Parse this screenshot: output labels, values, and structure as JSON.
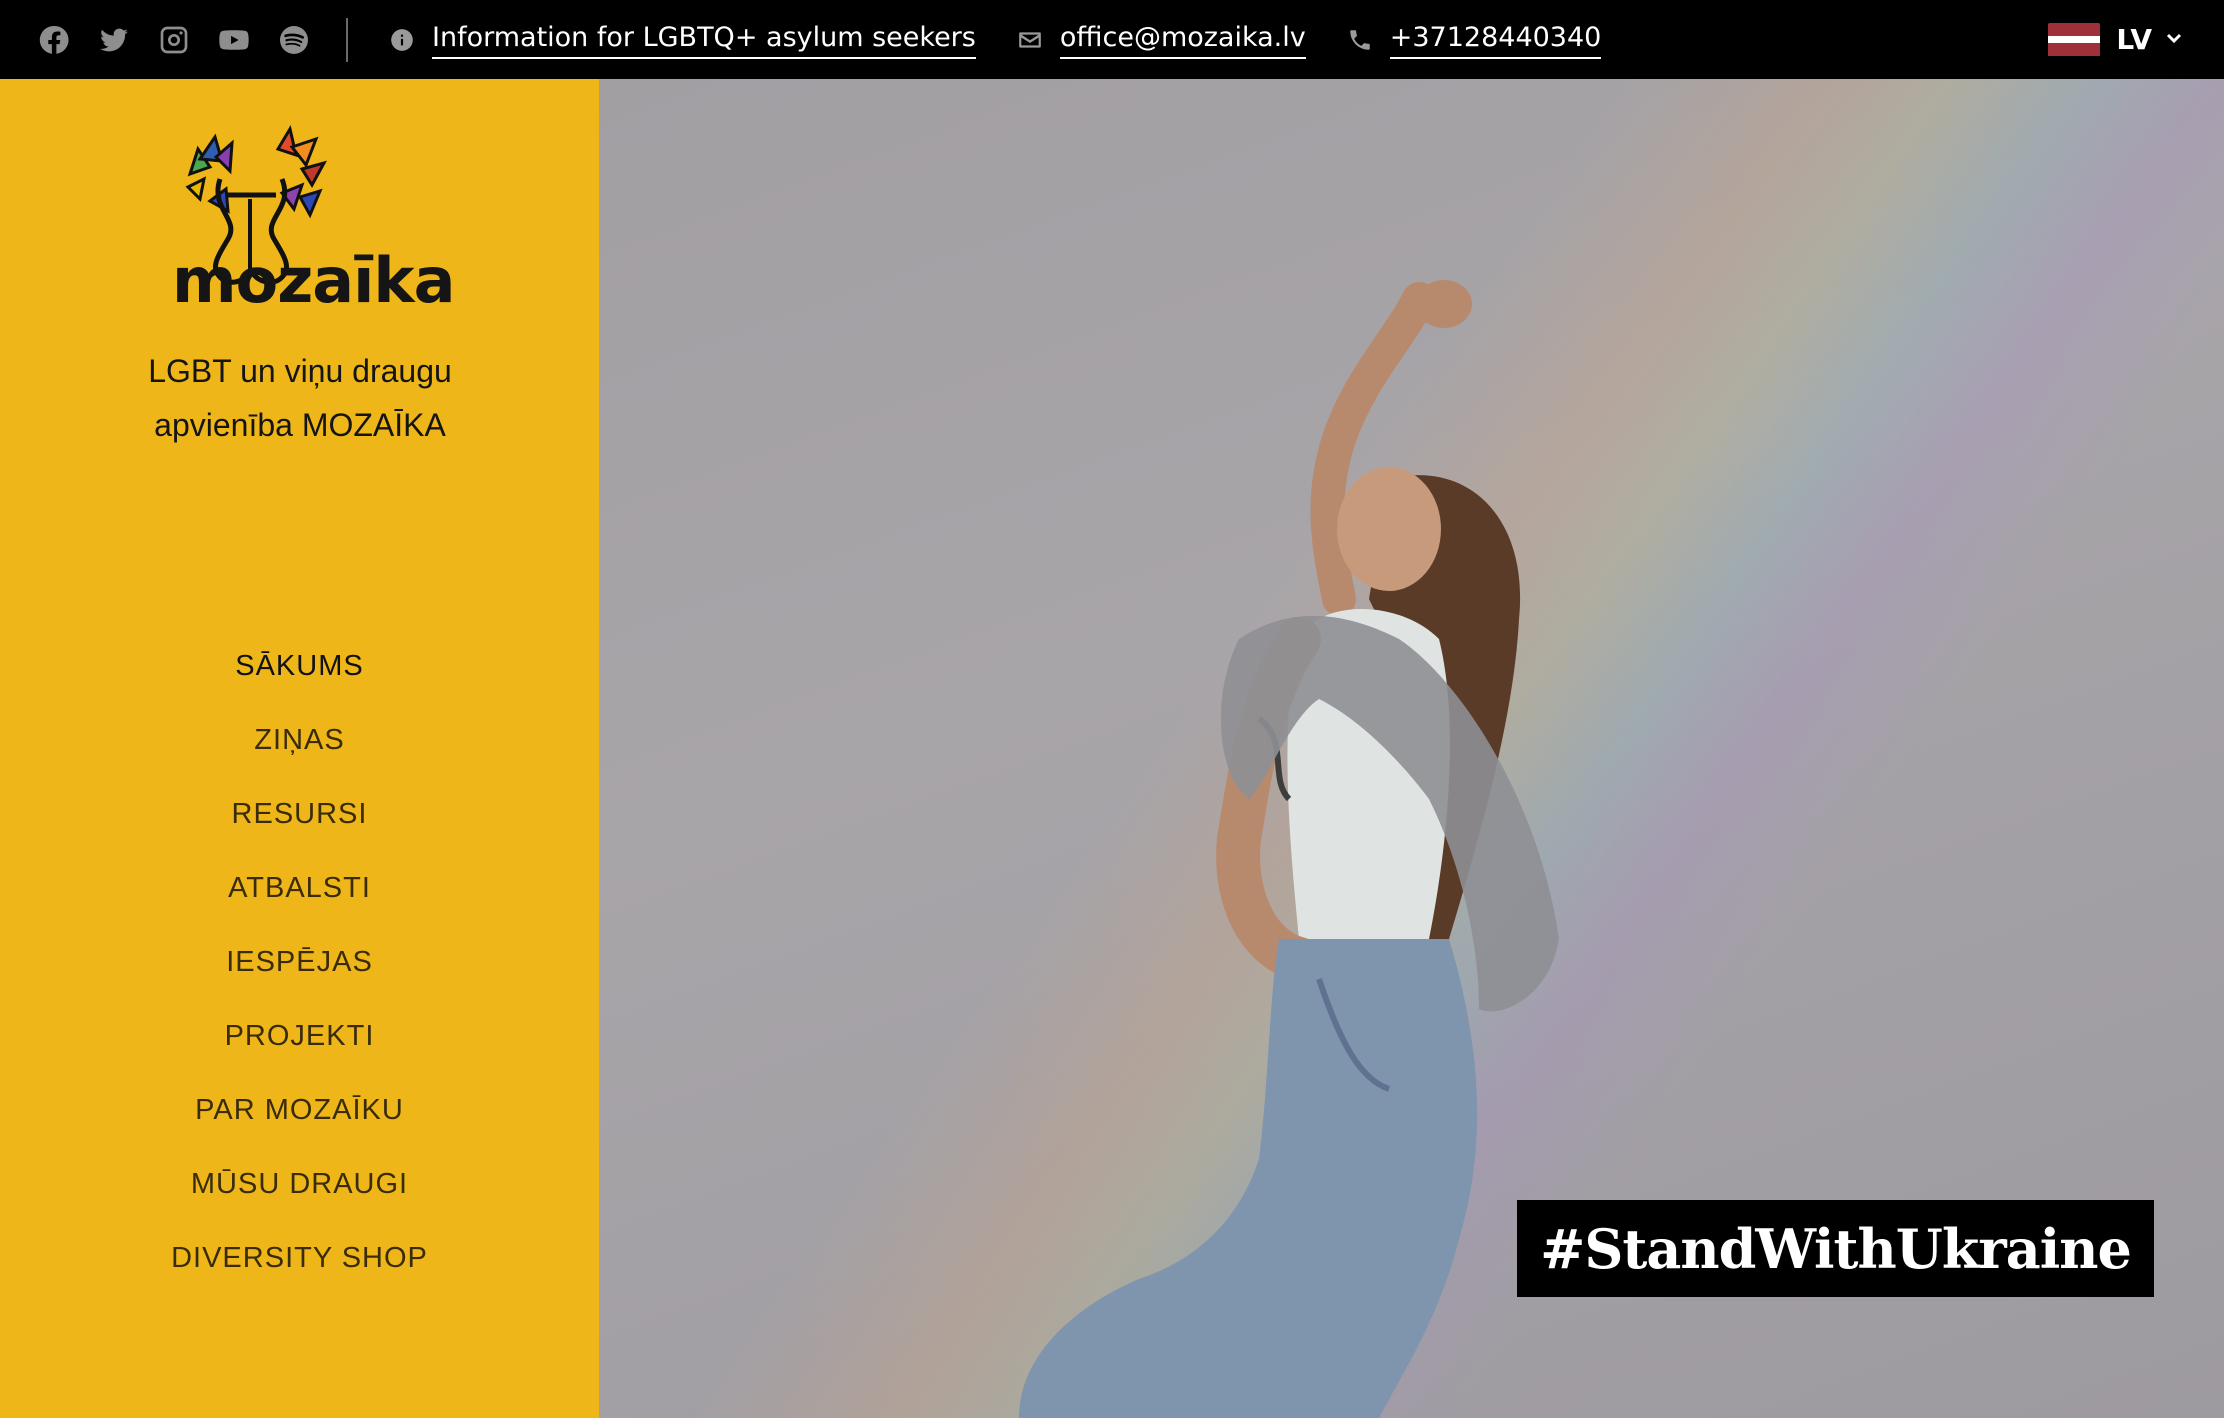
{
  "topbar": {
    "social": [
      {
        "icon": "facebook-icon"
      },
      {
        "icon": "twitter-icon"
      },
      {
        "icon": "instagram-icon"
      },
      {
        "icon": "youtube-icon"
      },
      {
        "icon": "spotify-icon"
      }
    ],
    "info_link": "Information for LGBTQ+ asylum seekers",
    "email": "office@mozaika.lv",
    "phone": "+37128440340",
    "language": "LV"
  },
  "sidebar": {
    "logo_text": "mozaīka",
    "tagline_line1": "LGBT un viņu draugu",
    "tagline_line2": "apvienība MOZAĪKA",
    "nav": [
      {
        "label": "SĀKUMS"
      },
      {
        "label": "ZIŅAS"
      },
      {
        "label": "RESURSI"
      },
      {
        "label": "ATBALSTI"
      },
      {
        "label": "IESPĒJAS"
      },
      {
        "label": "PROJEKTI"
      },
      {
        "label": "PAR MOZAĪKU"
      },
      {
        "label": "MŪSU DRAUGI"
      },
      {
        "label": "DIVERSITY SHOP"
      }
    ]
  },
  "hero": {
    "badge": "#StandWithUkraine"
  },
  "colors": {
    "sidebar_bg": "#efb61a",
    "topbar_bg": "#000000",
    "badge_bg": "#000000"
  }
}
